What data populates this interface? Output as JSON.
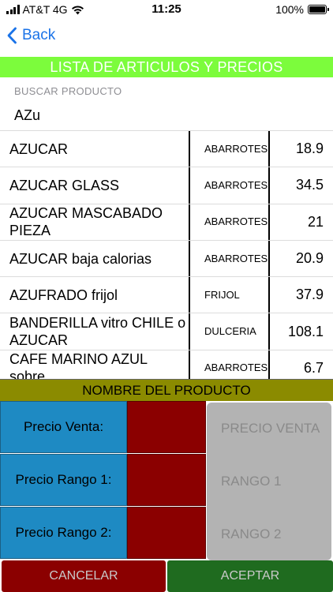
{
  "status_bar": {
    "carrier": "AT&T 4G",
    "time": "11:25",
    "battery": "100%"
  },
  "nav": {
    "back_label": "Back"
  },
  "header": {
    "title": "LISTA DE ARTICULOS Y PRECIOS"
  },
  "search": {
    "label": "BUSCAR PRODUCTO",
    "value": "AZu"
  },
  "products": [
    {
      "name": "AZUCAR",
      "category": "ABARROTES",
      "price": "18.9"
    },
    {
      "name": "AZUCAR GLASS",
      "category": "ABARROTES",
      "price": "34.5"
    },
    {
      "name": "AZUCAR MASCABADO PIEZA",
      "category": "ABARROTES",
      "price": "21"
    },
    {
      "name": "AZUCAR baja calorias",
      "category": "ABARROTES",
      "price": "20.9"
    },
    {
      "name": "AZUFRADO frijol",
      "category": "FRIJOL",
      "price": "37.9"
    },
    {
      "name": "BANDERILLA vitro CHILE o AZUCAR",
      "category": "DULCERIA",
      "price": "108.1"
    },
    {
      "name": "CAFE MARINO AZUL sobre",
      "category": "ABARROTES",
      "price": "6.7"
    }
  ],
  "detail": {
    "product_name_label": "NOMBRE DEL PRODUCTO",
    "price_sale_label": "Precio Venta:",
    "price_range1_label": "Precio Rango 1:",
    "price_range2_label": "Precio Rango 2:",
    "price_sale_placeholder": "PRECIO VENTA",
    "range1_placeholder": "RANGO 1",
    "range2_placeholder": "RANGO 2"
  },
  "actions": {
    "cancel_label": "CANCELAR",
    "accept_label": "ACEPTAR"
  },
  "colors": {
    "title_bar": "#7cfc3c",
    "product_bar": "#8b8b00",
    "label_blue": "#1e8ac3",
    "box_red": "#8b0000",
    "accept_green": "#1f6b1f",
    "link_blue": "#1a73e8"
  },
  "icons": {
    "back": "chevron-left-icon",
    "signal": "cell-signal-icon",
    "wifi": "wifi-icon",
    "battery": "battery-icon"
  }
}
